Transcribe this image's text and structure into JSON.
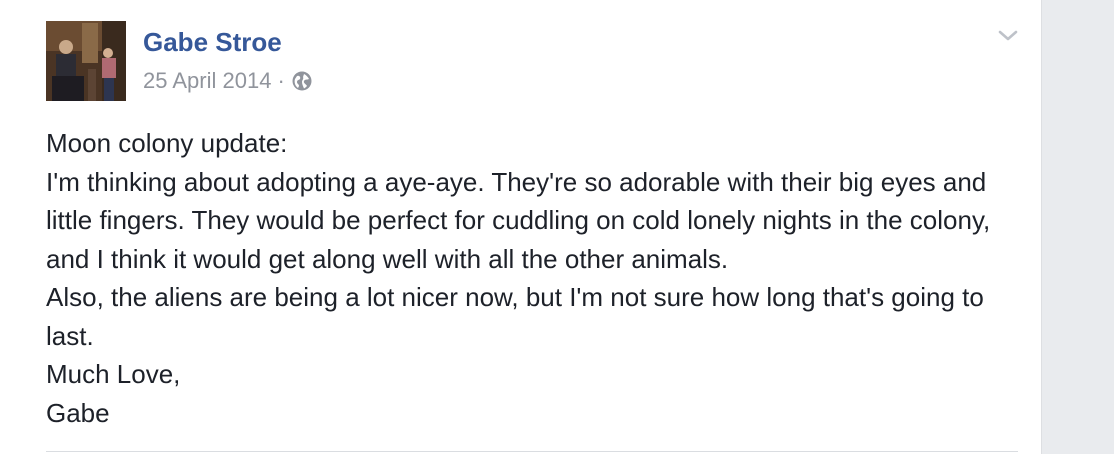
{
  "post": {
    "author": "Gabe Stroe",
    "date": "25 April 2014",
    "separator": "·",
    "privacy_icon": "globe-icon",
    "menu_icon": "chevron-down-icon",
    "lines": [
      "Moon colony update:",
      "I'm thinking about adopting a aye-aye. They're so adorable with their big eyes and little fingers. They would be perfect for cuddling on cold lonely nights in the colony, and I think it would get along well with all the other animals.",
      "Also, the aliens are being a lot nicer now, but I'm not sure how long that's going to last.",
      "Much Love,",
      "Gabe"
    ]
  },
  "colors": {
    "author_link": "#365899",
    "meta_text": "#90949c",
    "body_text": "#1d2129",
    "page_bg": "#e9ebee"
  }
}
